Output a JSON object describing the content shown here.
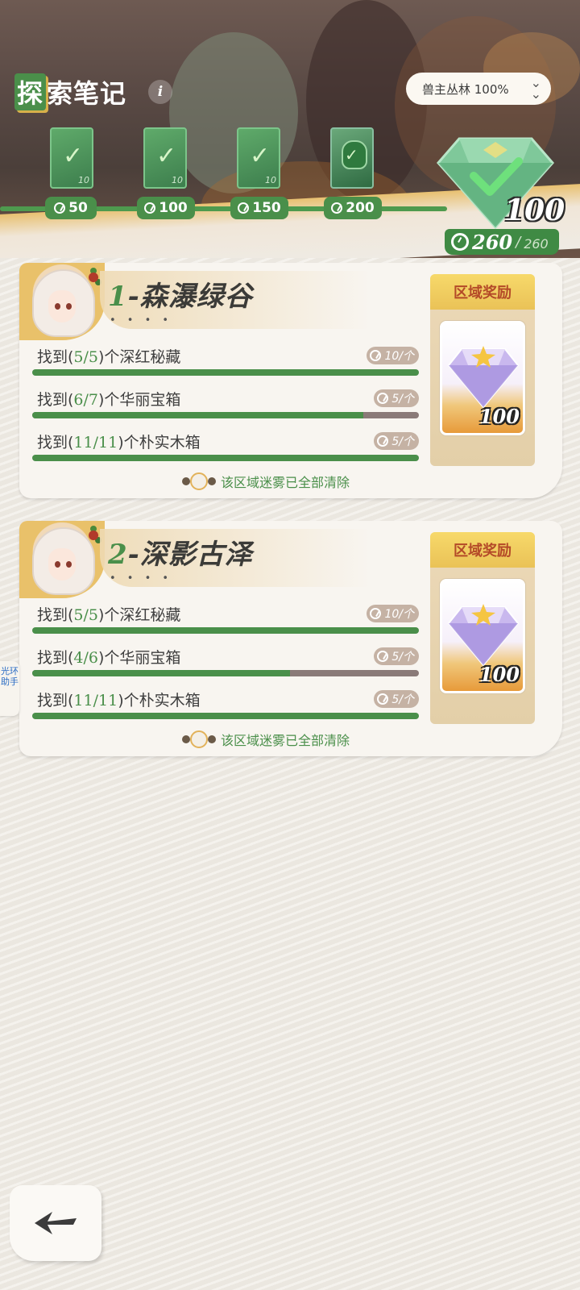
{
  "header": {
    "title_first": "探",
    "title_rest": "索笔记",
    "info_icon": "i",
    "region_select": "兽主丛林 100%",
    "milestones": [
      {
        "reward": "50",
        "card_num": "10",
        "state": "claimed"
      },
      {
        "reward": "100",
        "card_num": "10",
        "state": "claimed"
      },
      {
        "reward": "150",
        "card_num": "10",
        "state": "claimed"
      },
      {
        "reward": "200",
        "card_num": "",
        "state": "claimed"
      }
    ],
    "big_reward_amount": "100",
    "total_current": "260",
    "total_sep": "/",
    "total_max": "260"
  },
  "regions": [
    {
      "index": "1",
      "sep": "-",
      "name": "森瀑绿谷",
      "dots": "• • • •",
      "tasks": [
        {
          "prefix": "找到(",
          "count": "5/5",
          "suffix": ")个深红秘藏",
          "reward": "10/个",
          "progress": 1.0
        },
        {
          "prefix": "找到(",
          "count": "6/7",
          "suffix": ")个华丽宝箱",
          "reward": "5/个",
          "progress": 0.857
        },
        {
          "prefix": "找到(",
          "count": "11/11",
          "suffix": ")个朴实木箱",
          "reward": "5/个",
          "progress": 1.0
        }
      ],
      "fog_note": "该区域迷雾已全部清除",
      "reward_title": "区域奖励",
      "reward_amount": "100"
    },
    {
      "index": "2",
      "sep": "-",
      "name": "深影古泽",
      "dots": "• • • •",
      "tasks": [
        {
          "prefix": "找到(",
          "count": "5/5",
          "suffix": ")个深红秘藏",
          "reward": "10/个",
          "progress": 1.0
        },
        {
          "prefix": "找到(",
          "count": "4/6",
          "suffix": ")个华丽宝箱",
          "reward": "5/个",
          "progress": 0.667
        },
        {
          "prefix": "找到(",
          "count": "11/11",
          "suffix": ")个朴实木箱",
          "reward": "5/个",
          "progress": 1.0
        }
      ],
      "fog_note": "该区域迷雾已全部清除",
      "reward_title": "区域奖励",
      "reward_amount": "100"
    }
  ],
  "side_tab": "光环助手",
  "icons": {
    "info": "info-icon",
    "chevron": "double-chevron-down-icon",
    "coin": "coin-icon",
    "gem": "diamond-gem-icon",
    "back": "back-arrow-icon"
  },
  "colors": {
    "accent_green": "#4a8f4a",
    "bar_track": "#8a7a78",
    "reward_header": "#eac257",
    "reward_title_text": "#b44a28"
  }
}
